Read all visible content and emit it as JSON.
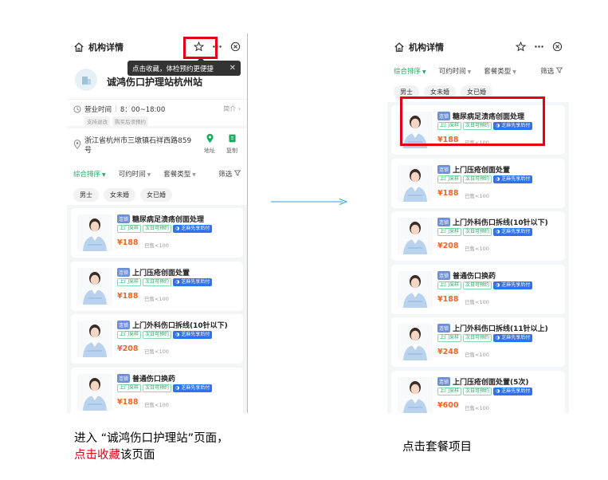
{
  "header": {
    "title": "机构详情"
  },
  "tooltip": {
    "text": "点击收藏，体检预约更便捷"
  },
  "org": {
    "name": "诚鸿伤口护理站杭州站"
  },
  "hours": {
    "label": "营业时间",
    "value": "8：00~18:00",
    "more": "简介",
    "tags": [
      "支持退改",
      "购买后须预约"
    ]
  },
  "address": {
    "text": "浙江省杭州市三墩镇石祥西路859号",
    "nav_label": "地址",
    "copy_label": "复制"
  },
  "filters": [
    {
      "label": "综合排序",
      "caret": "▼"
    },
    {
      "label": "可约时间",
      "caret": "▼"
    },
    {
      "label": "套餐类型",
      "caret": "▼"
    }
  ],
  "filter_button": "筛选",
  "chips": [
    "男士",
    "女未婚",
    "女已婚"
  ],
  "card_tag": "连锁",
  "card_badges": [
    "上门采样",
    "次日可预约",
    "芝麻先享后付"
  ],
  "left_products": [
    {
      "title": "糖尿病足溃疡创面处理",
      "price": "¥188",
      "sold": "已售<100"
    },
    {
      "title": "上门压疮创面处置",
      "price": "¥188",
      "sold": "已售<100"
    },
    {
      "title": "上门外科伤口拆线(10针以下)",
      "price": "¥208",
      "sold": "已售<100"
    },
    {
      "title": "普通伤口换药",
      "price": "¥188",
      "sold": "已售<100"
    }
  ],
  "right_products": [
    {
      "title": "糖尿病足溃疡创面处理",
      "price": "¥188",
      "sold": "已售<100"
    },
    {
      "title": "上门压疮创面处置",
      "price": "¥188",
      "sold": "已售<100"
    },
    {
      "title": "上门外科伤口拆线(10针以下)",
      "price": "¥208",
      "sold": "已售<100"
    },
    {
      "title": "普通伤口换药",
      "price": "¥188",
      "sold": "已售<100"
    },
    {
      "title": "上门外科伤口拆线(11针以上)",
      "price": "¥248",
      "sold": "已售<100"
    },
    {
      "title": "上门压疮创面处置(5次)",
      "price": "¥600",
      "sold": "已售<100"
    }
  ],
  "captions": {
    "left_line1": "进入 “诚鸿伤口护理站”页面，",
    "left_line2_red": "点击收藏",
    "left_line2_rest": "该页面",
    "right": "点击套餐项目"
  },
  "colors": {
    "accent_green": "#1aad5f",
    "price_orange": "#f26522",
    "highlight_red": "#e60012",
    "arrow_blue": "#2aa7e0"
  },
  "icons": [
    "home-icon",
    "star-icon",
    "more-icon",
    "close-circle-icon",
    "clock-icon",
    "location-icon",
    "navigate-icon",
    "copy-icon",
    "filter-icon",
    "avatar-icon"
  ]
}
